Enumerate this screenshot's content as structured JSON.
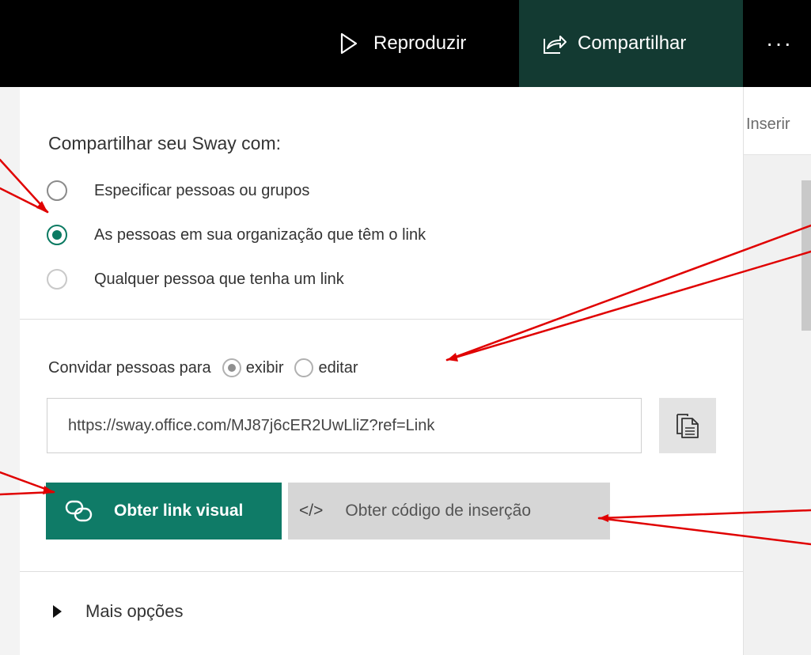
{
  "topbar": {
    "play_label": "Reproduzir",
    "share_label": "Compartilhar",
    "more_label": "···"
  },
  "right_panel": {
    "insert_label": "Inserir"
  },
  "share_panel": {
    "heading": "Compartilhar seu Sway com:",
    "audience_options": [
      {
        "label": "Especificar pessoas ou grupos",
        "selected": false
      },
      {
        "label": "As pessoas em sua organização que têm o link",
        "selected": true
      },
      {
        "label": "Qualquer pessoa que tenha um link",
        "selected": false
      }
    ],
    "invite_label": "Convidar pessoas para",
    "permission_options": [
      {
        "label": "exibir",
        "selected": true
      },
      {
        "label": "editar",
        "selected": false
      }
    ],
    "link_value": "https://sway.office.com/MJ87j6cER2UwLliZ?ref=Link",
    "visual_link_label": "Obter link visual",
    "embed_code_label": "Obter código de inserção",
    "embed_code_glyph": "</>",
    "more_options_label": "Mais opções"
  },
  "colors": {
    "topbar": "#000000",
    "share_active": "#133a32",
    "accent": "#0f7b67",
    "annotation": "#e00000"
  }
}
